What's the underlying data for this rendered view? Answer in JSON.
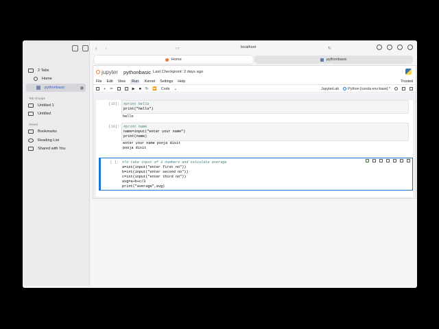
{
  "sidebar": {
    "items": [
      {
        "label": "2 Tabs"
      },
      {
        "label": "Home"
      },
      {
        "label": "pythonbasic"
      }
    ],
    "tab_groups_heading": "Tab Groups",
    "tab_groups": [
      "Untitled 1",
      "Untitled"
    ],
    "saved_heading": "Saved",
    "saved": [
      "Bookmarks",
      "Reading List",
      "Shared with You"
    ]
  },
  "browser": {
    "address": "localhost",
    "tabs": [
      {
        "label": "Home"
      },
      {
        "label": "pythonbasic"
      }
    ]
  },
  "jupyter": {
    "logo_text": "jupyter",
    "notebook_name": "pythonbasic",
    "checkpoint": "Last Checkpoint: 2 days ago",
    "menu": [
      "File",
      "Edit",
      "View",
      "Run",
      "Kernel",
      "Settings",
      "Help"
    ],
    "trusted": "Trusted",
    "cell_type": "Code",
    "jupyterlab_label": "JupyterLab",
    "kernel": "Python [conda env:base] *"
  },
  "cells": [
    {
      "prompt": "[15]:",
      "code": [
        "#print hello",
        "print(\"hello\")"
      ],
      "output": [
        "hello"
      ]
    },
    {
      "prompt": "[16]:",
      "code": [
        "#print name",
        "name=input(\"enter your name\")",
        "print(name)"
      ],
      "output": [
        "enter your name pooja dixit",
        "pooja dixit"
      ]
    },
    {
      "prompt": "[ ]:",
      "code": [
        "#To take input of 3 numbers and calculate average",
        "a=int(input(\"enter first no\"))",
        "b=int(input(\"enter second no\"))",
        "c=int(input(\"enter third no\"))",
        "avg=a+b+c/3",
        "print(\"average\",avg)"
      ],
      "output": []
    }
  ],
  "colors": {
    "accent": "#1976d2",
    "jupyter_orange": "#f37726"
  }
}
